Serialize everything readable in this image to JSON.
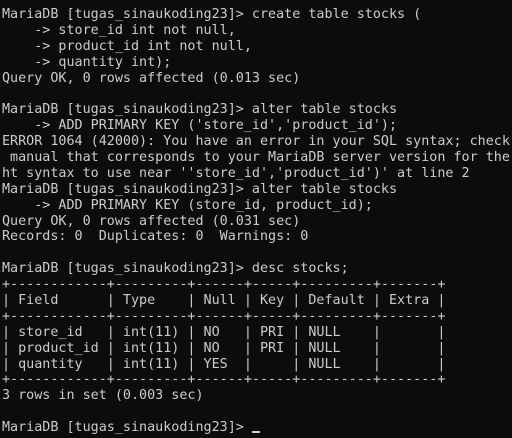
{
  "terminal": {
    "colors": {
      "background": "#0c0c0c",
      "text": "#cccccc"
    },
    "lines": [
      "MariaDB [tugas_sinaukoding23]> create table stocks (",
      "    -> store_id int not null,",
      "    -> product_id int not null,",
      "    -> quantity int);",
      "Query OK, 0 rows affected (0.013 sec)",
      "",
      "MariaDB [tugas_sinaukoding23]> alter table stocks",
      "    -> ADD PRIMARY KEY ('store_id','product_id');",
      "ERROR 1064 (42000): You have an error in your SQL syntax; check",
      " manual that corresponds to your MariaDB server version for the",
      "ht syntax to use near ''store_id','product_id')' at line 2",
      "MariaDB [tugas_sinaukoding23]> alter table stocks",
      "    -> ADD PRIMARY KEY (store_id, product_id);",
      "Query OK, 0 rows affected (0.031 sec)",
      "Records: 0  Duplicates: 0  Warnings: 0",
      "",
      "MariaDB [tugas_sinaukoding23]> desc stocks;",
      "+------------+---------+------+-----+---------+-------+",
      "| Field      | Type    | Null | Key | Default | Extra |",
      "+------------+---------+------+-----+---------+-------+",
      "| store_id   | int(11) | NO   | PRI | NULL    |       |",
      "| product_id | int(11) | NO   | PRI | NULL    |       |",
      "| quantity   | int(11) | YES  |     | NULL    |       |",
      "+------------+---------+------+-----+---------+-------+",
      "3 rows in set (0.003 sec)",
      ""
    ],
    "prompt": "MariaDB [tugas_sinaukoding23]> ",
    "input_value": ""
  }
}
